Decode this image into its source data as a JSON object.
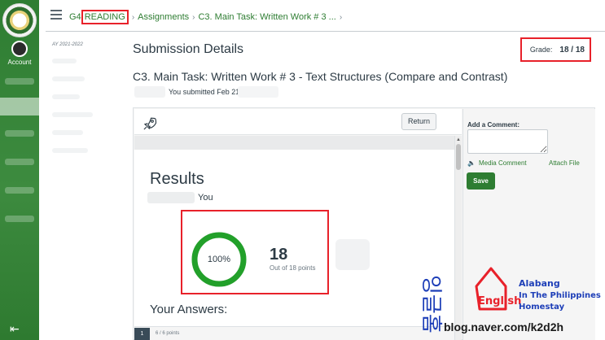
{
  "global_nav": {
    "account_label": "Account"
  },
  "breadcrumb": {
    "course": "G4",
    "section": "READING",
    "assignments": "Assignments",
    "assignment": "C3. Main Task: Written Work # 3 ..."
  },
  "course_nav": {
    "year": "AY 2021-2022"
  },
  "page": {
    "title": "Submission Details",
    "grade_label": "Grade:",
    "grade_value": "18 / 18",
    "assignment_title": "C3. Main Task: Written Work # 3 - Text Structures (Compare and Contrast)",
    "submitted_text": "You submitted Feb 21"
  },
  "viewer": {
    "return_label": "Return",
    "results_title": "Results",
    "you_label": "You",
    "percent": "100%",
    "percent_value": 100,
    "score": "18",
    "out_of": "Out of 18 points",
    "answers_title": "Your Answers:",
    "question_number": "1",
    "question_points": "6 / 6 points"
  },
  "comment_panel": {
    "add_comment_label": "Add a Comment:",
    "media_comment": "Media Comment",
    "attach_file": "Attach File",
    "save_label": "Save"
  },
  "watermark": {
    "korean": "잉글홈",
    "english": "English",
    "alabang": "Alabang",
    "philippines": "In The Philippines",
    "homestay": "Homestay",
    "url": "blog.naver.com/k2d2h"
  },
  "colors": {
    "brand_green": "#2e7d32",
    "ring_green": "#22a02a",
    "highlight_red": "#e8212a",
    "text_dark": "#2d3b45"
  }
}
